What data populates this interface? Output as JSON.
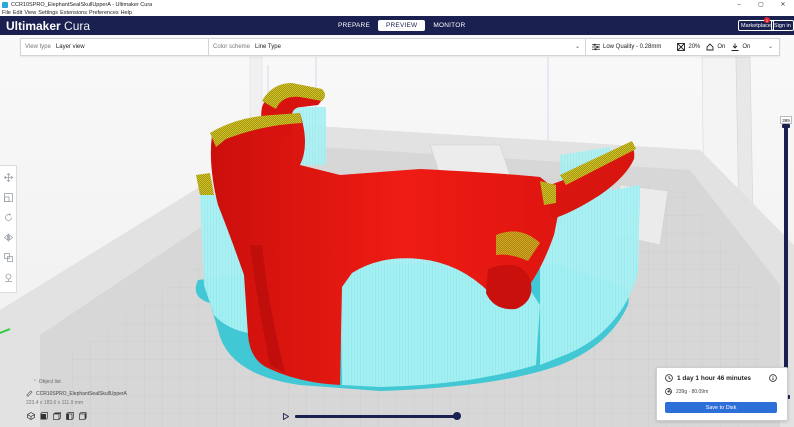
{
  "window": {
    "title": "CCR10SPRO_ElephantSealSkullUpperA - Ultimaker Cura",
    "controls": [
      "–",
      "▢",
      "✕"
    ]
  },
  "menu": [
    "File",
    "Edit",
    "View",
    "Settings",
    "Extensions",
    "Preferences",
    "Help"
  ],
  "header": {
    "logo_bold": "Ultimaker",
    "logo_light": " Cura",
    "tabs": [
      {
        "label": "PREPARE",
        "active": false
      },
      {
        "label": "PREVIEW",
        "active": true
      },
      {
        "label": "MONITOR",
        "active": false
      }
    ],
    "marketplace_label": "Marketplace",
    "notification_count": "1",
    "signin_label": "Sign in"
  },
  "toolbar": {
    "view_type_label": "View type",
    "view_type_value": "Layer view",
    "color_scheme_label": "Color scheme",
    "color_scheme_value": "Line Type",
    "quality": "Low Quality - 0.28mm",
    "infill": "20%",
    "support": "On",
    "adhesion": "On"
  },
  "left_tools": [
    "move-icon",
    "scale-icon",
    "rotate-icon",
    "mirror-icon",
    "per-model-settings-icon",
    "support-blocker-icon"
  ],
  "layer_slider": {
    "current_layer": "399"
  },
  "object_list": {
    "header": "Object list",
    "object_name": "CCR10SPRO_ElephantSealSkullUpperA",
    "dimensions": "223.4 x 183.6 x 111.9 mm"
  },
  "print_info": {
    "time": "1 day 1 hour 46 minutes",
    "material": "239g · 80.09m",
    "save_label": "Save to Disk"
  },
  "colors": {
    "header_bg": "#1a2050",
    "accent_blue": "#2d6fd8",
    "model_wall": "#e8140f",
    "model_top": "#c9b820",
    "support": "#8ee8ee",
    "skirt": "#27c6d4"
  }
}
